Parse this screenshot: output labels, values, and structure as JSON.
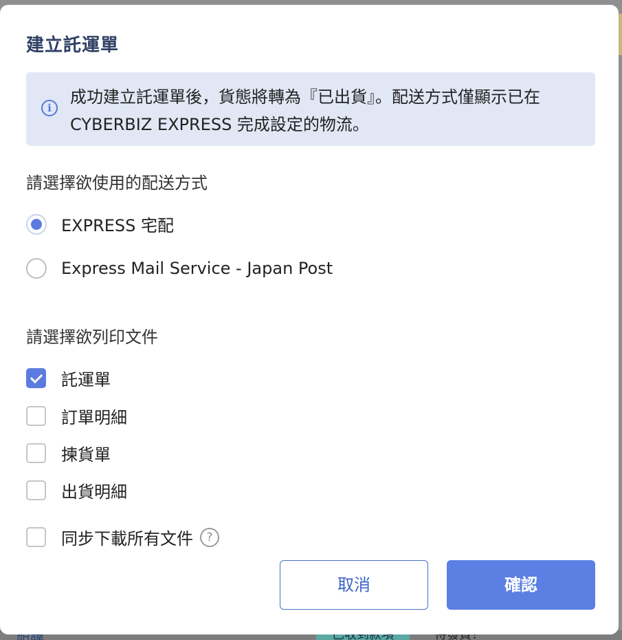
{
  "backdrop": {
    "link_text": "組譯",
    "chip_text": "已收到款項",
    "status_text": "待發貨！"
  },
  "modal": {
    "title": "建立託運單",
    "notice": {
      "icon": "info-icon",
      "line1": "成功建立託運單後，貨態將轉為『已出貨』。配送方式僅顯示已在",
      "line2": "CYBERBIZ EXPRESS 完成設定的物流。"
    },
    "shipping": {
      "label": "請選擇欲使用的配送方式",
      "options": [
        {
          "label": "EXPRESS 宅配",
          "selected": true
        },
        {
          "label": "Express Mail Service - Japan Post",
          "selected": false
        }
      ]
    },
    "documents": {
      "label": "請選擇欲列印文件",
      "items": [
        {
          "label": "託運單",
          "checked": true
        },
        {
          "label": "訂單明細",
          "checked": false
        },
        {
          "label": "揀貨單",
          "checked": false
        },
        {
          "label": "出貨明細",
          "checked": false
        }
      ]
    },
    "download_all": {
      "label": "同步下載所有文件",
      "checked": false,
      "help_icon": "question-circle-icon",
      "help_glyph": "?"
    },
    "buttons": {
      "cancel": "取消",
      "confirm": "確認"
    }
  },
  "colors": {
    "accent": "#5b7fe3",
    "title": "#2f3f64",
    "notice_bg": "#e1e7f5"
  }
}
